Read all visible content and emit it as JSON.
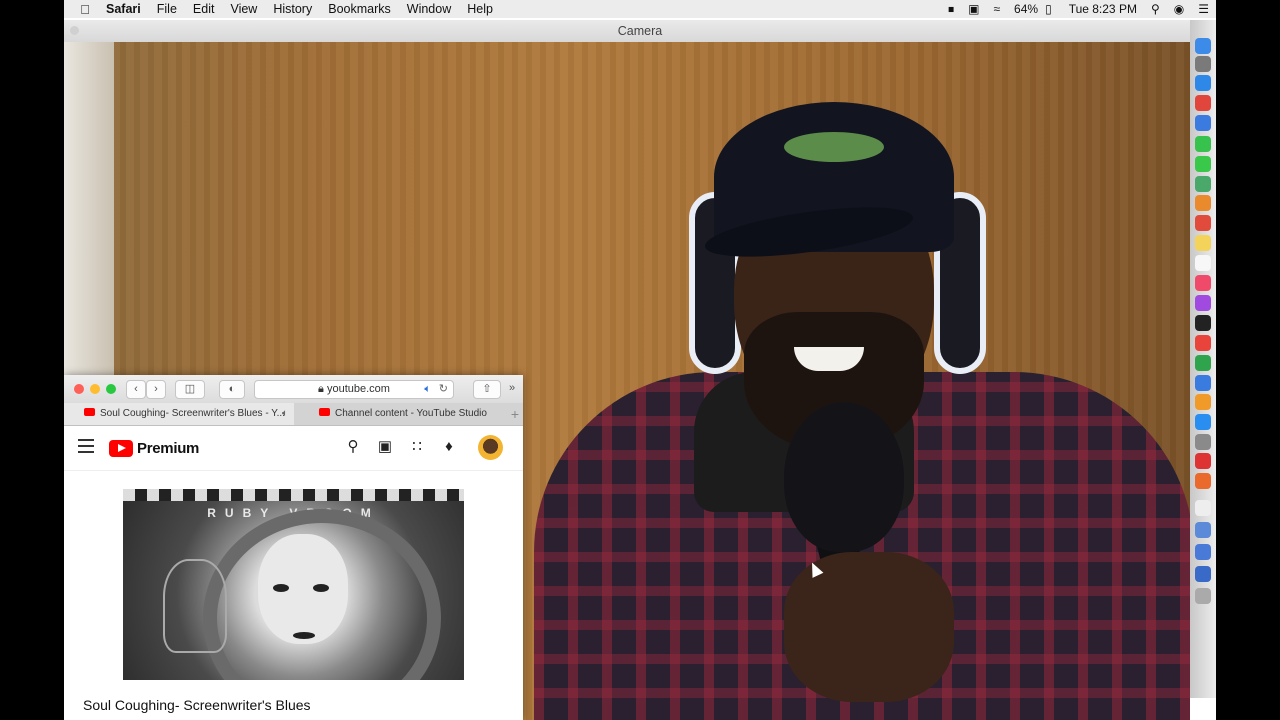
{
  "menubar": {
    "apple_icon": "apple-logo",
    "items": [
      {
        "label": "Safari",
        "bold": true
      },
      {
        "label": "File"
      },
      {
        "label": "Edit"
      },
      {
        "label": "View"
      },
      {
        "label": "History"
      },
      {
        "label": "Bookmarks"
      },
      {
        "label": "Window"
      },
      {
        "label": "Help"
      }
    ],
    "battery": "64%",
    "clock": "Tue 8:23 PM"
  },
  "camera_window": {
    "title": "Camera"
  },
  "safari": {
    "url": "youtube.com",
    "tabs": [
      {
        "label": "Soul Coughing- Screenwriter's Blues - Y..."
      },
      {
        "label": "Channel content - YouTube Studio"
      }
    ],
    "youtube": {
      "brand": "Premium",
      "thumbnail_text": "RUBY VROOM",
      "video_title": "Soul Coughing- Screenwriter's Blues"
    }
  },
  "dock": {
    "icons": [
      "finder-icon",
      "launchpad-icon",
      "safari-icon",
      "chrome-icon",
      "mail-icon",
      "messages-icon",
      "facetime-icon",
      "maps-icon",
      "photos-icon",
      "calendar-icon",
      "notes-icon",
      "reminders-icon",
      "music-icon",
      "podcasts-icon",
      "tv-icon",
      "news-icon",
      "numbers-icon",
      "keynote-icon",
      "pages-icon",
      "appstore-icon",
      "preferences-icon",
      "screenflow-icon",
      "obs-icon",
      "textedit-icon",
      "preview-icon",
      "downloads-icon",
      "documents-icon",
      "trash-icon"
    ]
  }
}
